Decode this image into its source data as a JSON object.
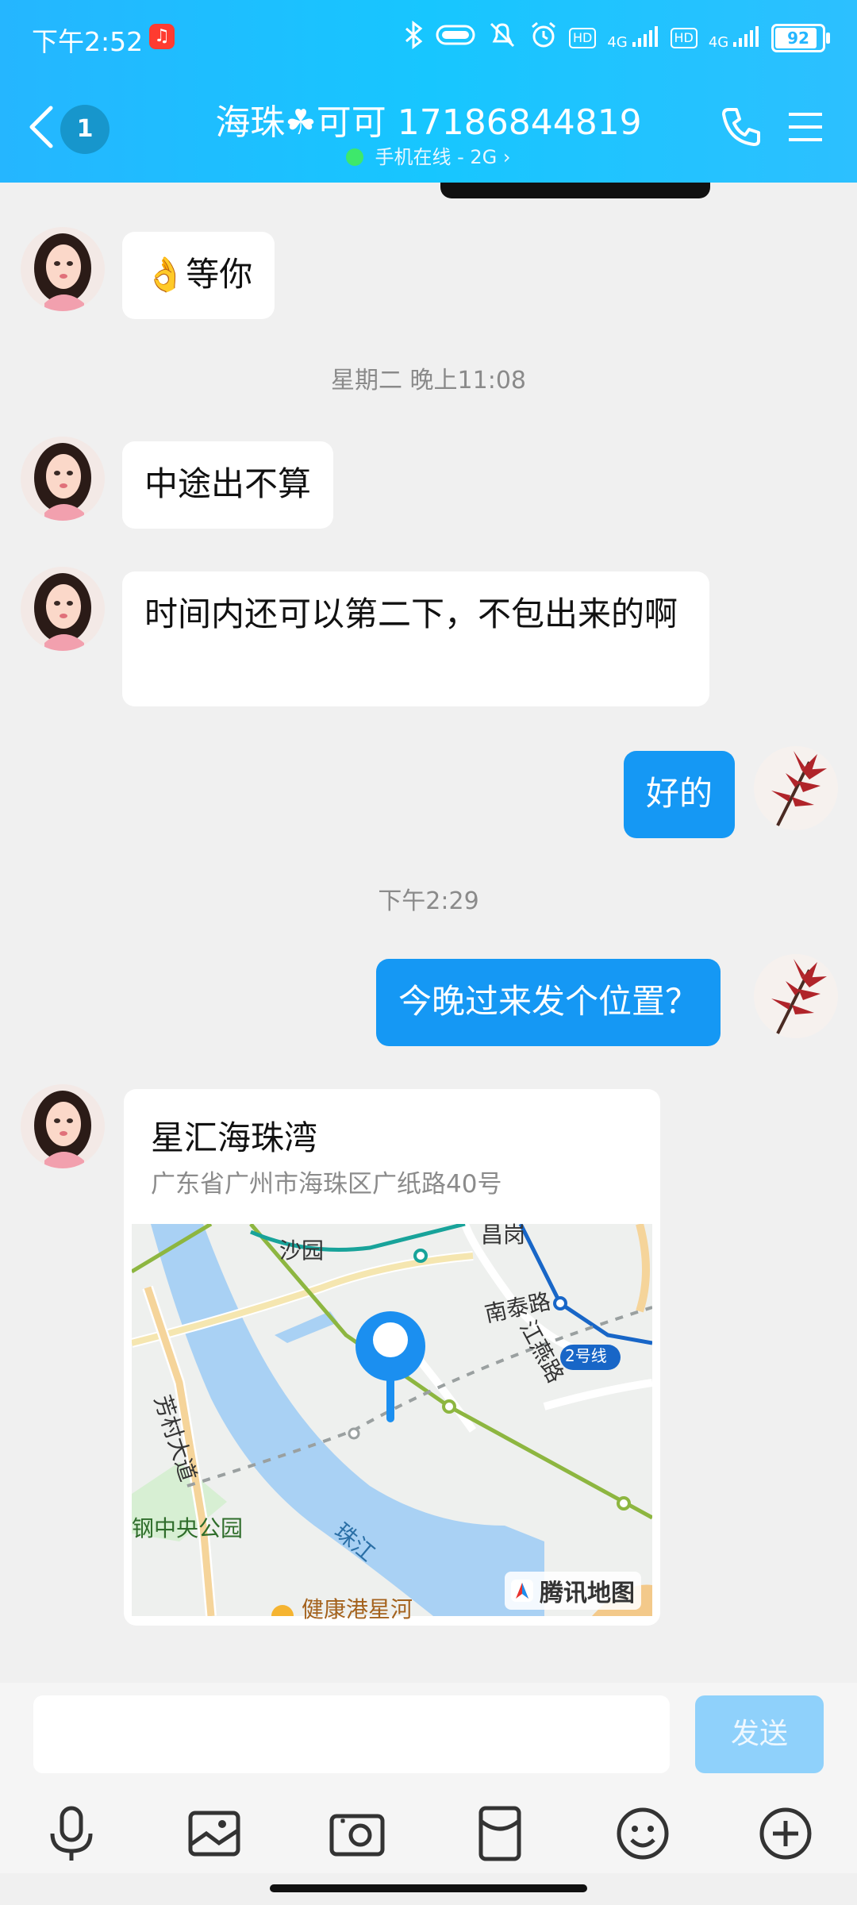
{
  "status_bar": {
    "time": "下午2:52",
    "battery": "92",
    "net1": "4G",
    "net2": "4G"
  },
  "header": {
    "unread_count": "1",
    "title": "海珠☘可可 17186844819",
    "subtitle": "手机在线 - 2G"
  },
  "messages": [
    {
      "side": "in",
      "text": "👌等你"
    },
    {
      "type": "time",
      "text": "星期二 晚上11:08"
    },
    {
      "side": "in",
      "text": "中途出不算"
    },
    {
      "side": "in",
      "text": "时间内还可以第二下，不包出来的啊"
    },
    {
      "side": "out",
      "text": "好的"
    },
    {
      "type": "time",
      "text": "下午2:29"
    },
    {
      "side": "out",
      "text": "今晚过来发个位置？"
    }
  ],
  "location": {
    "name": "星汇海珠湾",
    "address": "广东省广州市海珠区广纸路40号",
    "map_labels": {
      "a": "沙园",
      "b": "南泰路",
      "c": "江燕路",
      "d": "2号线",
      "e": "芳村大道",
      "f": "钢中央公园",
      "g": "珠江",
      "h": "健康港星河",
      "i": "昌岗"
    },
    "brand": "腾讯地图"
  },
  "input": {
    "send_label": "发送"
  },
  "colors": {
    "header": "#25b6ff",
    "bubble_out": "#1598f4",
    "send_disabled": "#8fd1fb"
  }
}
